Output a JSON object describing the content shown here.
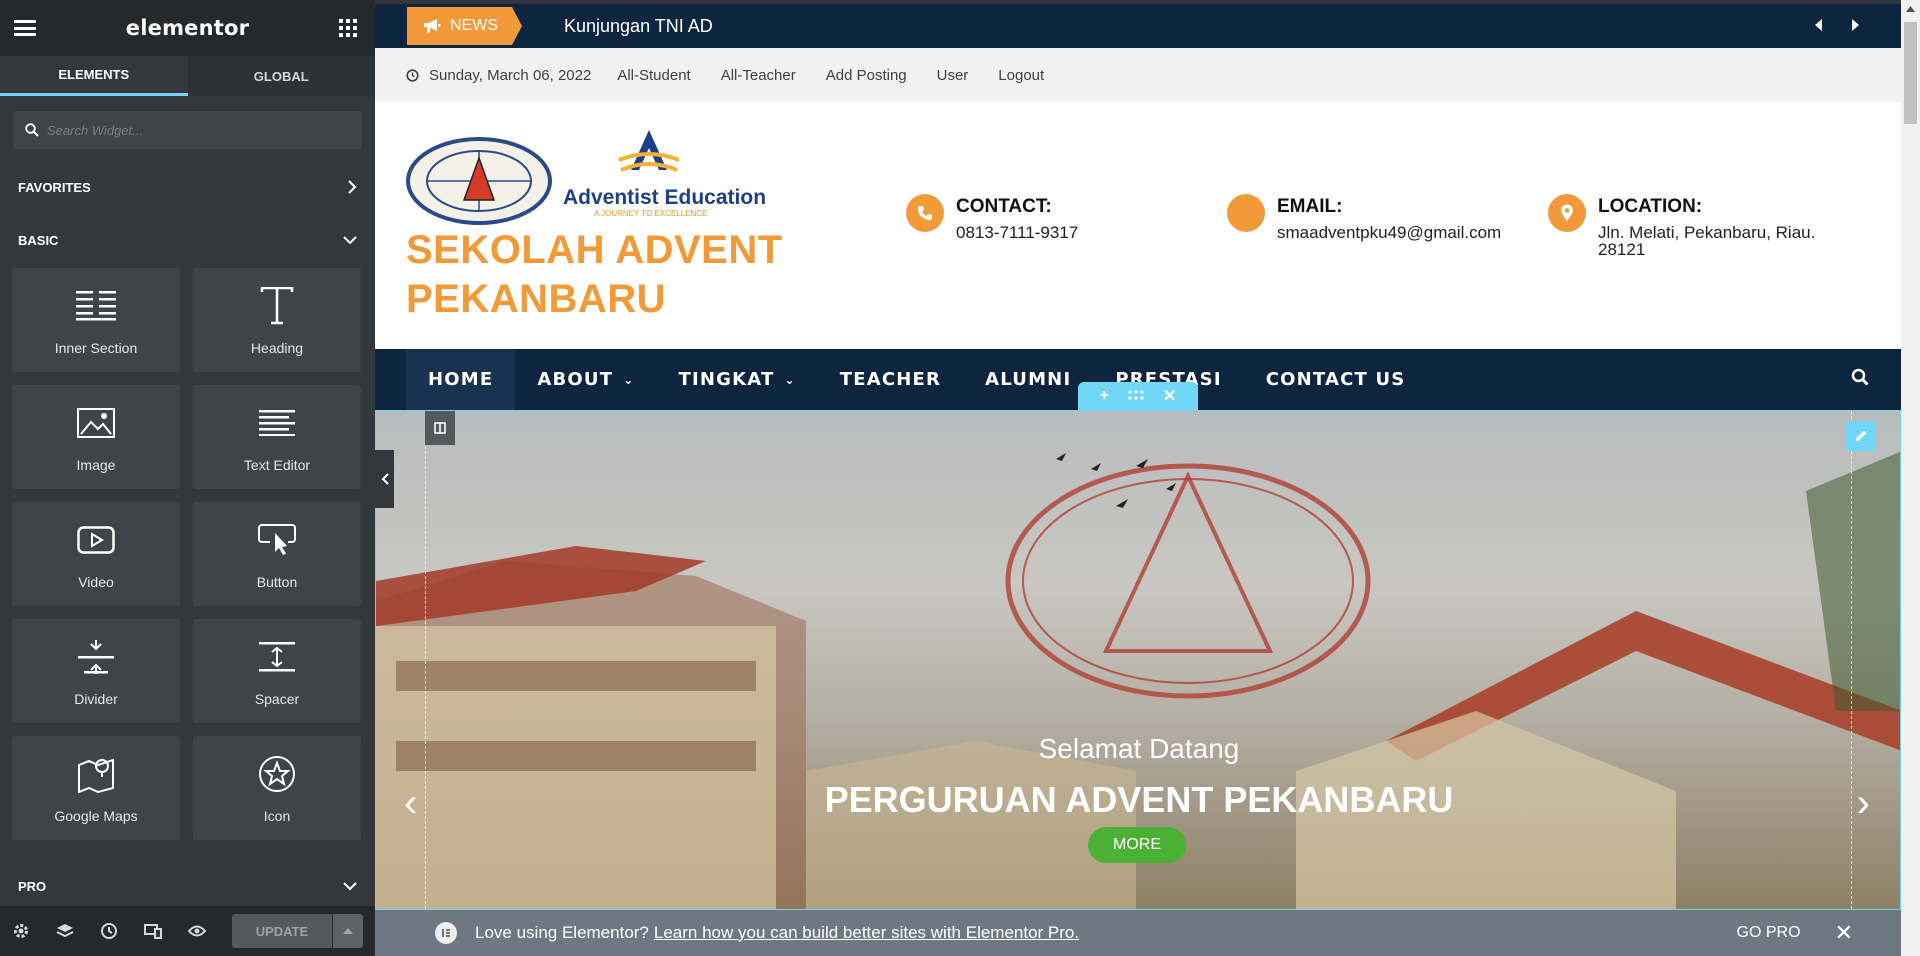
{
  "panel": {
    "brand": "elementor",
    "tabs": [
      "ELEMENTS",
      "GLOBAL"
    ],
    "search_placeholder": "Search Widget...",
    "favorites_label": "FAVORITES",
    "basic_label": "BASIC",
    "pro_label": "PRO",
    "widgets": [
      "Inner Section",
      "Heading",
      "Image",
      "Text Editor",
      "Video",
      "Button",
      "Divider",
      "Spacer",
      "Google Maps",
      "Icon"
    ],
    "update_label": "UPDATE"
  },
  "site": {
    "news_label": "NEWS",
    "news_title": "Kunjungan TNI AD",
    "date": "Sunday, March 06, 2022",
    "top_links": [
      "All-Student",
      "All-Teacher",
      "Add Posting",
      "User",
      "Logout"
    ],
    "logo_text": "Adventist Education",
    "logo_tagline": "A JOURNEY TO EXCELLENCE",
    "site_name": "SEKOLAH ADVENT PEKANBARU",
    "contact": {
      "title": "CONTACT:",
      "value": "0813-7111-9317"
    },
    "email": {
      "title": "EMAIL:",
      "value": "smaadventpku49@gmail.com"
    },
    "location": {
      "title": "LOCATION:",
      "value": "Jln. Melati, Pekanbaru, Riau. 28121"
    },
    "nav": [
      "HOME",
      "ABOUT",
      "TINGKAT",
      "TEACHER",
      "ALUMNI",
      "PRESTASI",
      "CONTACT US"
    ],
    "slide_subtitle": "Selamat Datang",
    "slide_title": "PERGURUAN ADVENT PEKANBARU",
    "slide_button": "MORE"
  },
  "promo": {
    "text": "Love using Elementor?",
    "link": "Learn how you can build better sites with Elementor Pro.",
    "gopro": "GO PRO"
  },
  "colors": {
    "accent": "#f29a3a",
    "navy": "#0e2540",
    "elementor_blue": "#71d7f7",
    "panel_bg": "#34383c",
    "button_green": "#4ab135"
  }
}
